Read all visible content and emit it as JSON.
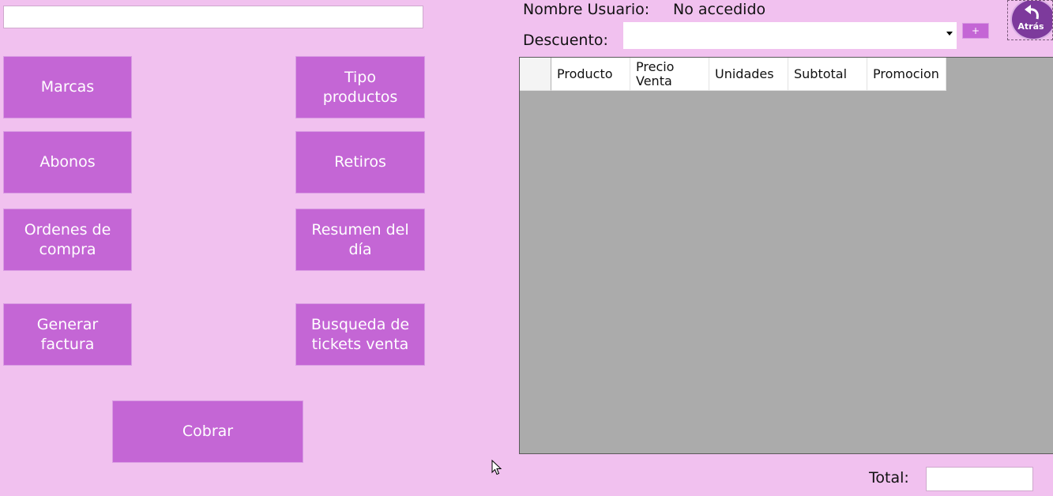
{
  "search": {
    "value": ""
  },
  "buttons": {
    "marcas": "Marcas",
    "tipo_productos": "Tipo\nproductos",
    "abonos": "Abonos",
    "retiros": "Retiros",
    "ordenes_compra": "Ordenes de\ncompra",
    "resumen_dia": "Resumen del\ndía",
    "generar_factura": "Generar\nfactura",
    "busqueda_tickets": "Busqueda de\ntickets venta",
    "cobrar": "Cobrar"
  },
  "user": {
    "label": "Nombre Usuario:",
    "value": "No accedido"
  },
  "discount": {
    "label": "Descuento:",
    "selected": "",
    "add_label": "+"
  },
  "back": {
    "label": "Atrás",
    "icon": "back-arrow-icon"
  },
  "table": {
    "columns": [
      "Producto",
      "Precio\nVenta",
      "Unidades",
      "Subtotal",
      "Promocion"
    ],
    "rows": []
  },
  "total": {
    "label": "Total:",
    "value": ""
  },
  "colors": {
    "background": "#f1c1ef",
    "button": "#c466d5",
    "grid_background": "#ababab",
    "back_button": "#7d3a9c"
  }
}
